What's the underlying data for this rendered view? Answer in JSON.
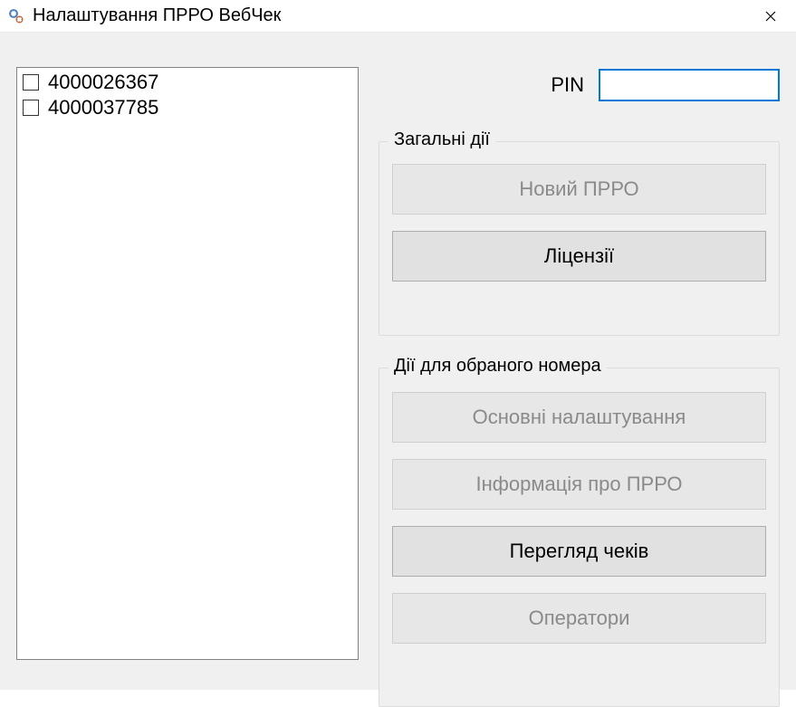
{
  "window": {
    "title": "Налаштування ПРРО ВебЧек"
  },
  "list": {
    "items": [
      {
        "id": "4000026367",
        "checked": false
      },
      {
        "id": "4000037785",
        "checked": false
      }
    ]
  },
  "pin": {
    "label": "PIN",
    "value": ""
  },
  "general_actions": {
    "title": "Загальні дії",
    "new_prro": "Новий ПРРО",
    "licenses": "Ліцензії"
  },
  "selected_actions": {
    "title": "Дії для обраного номера",
    "main_settings": "Основні налаштування",
    "info": "Інформація про ПРРО",
    "view_checks": "Перегляд чеків",
    "operators": "Оператори"
  }
}
